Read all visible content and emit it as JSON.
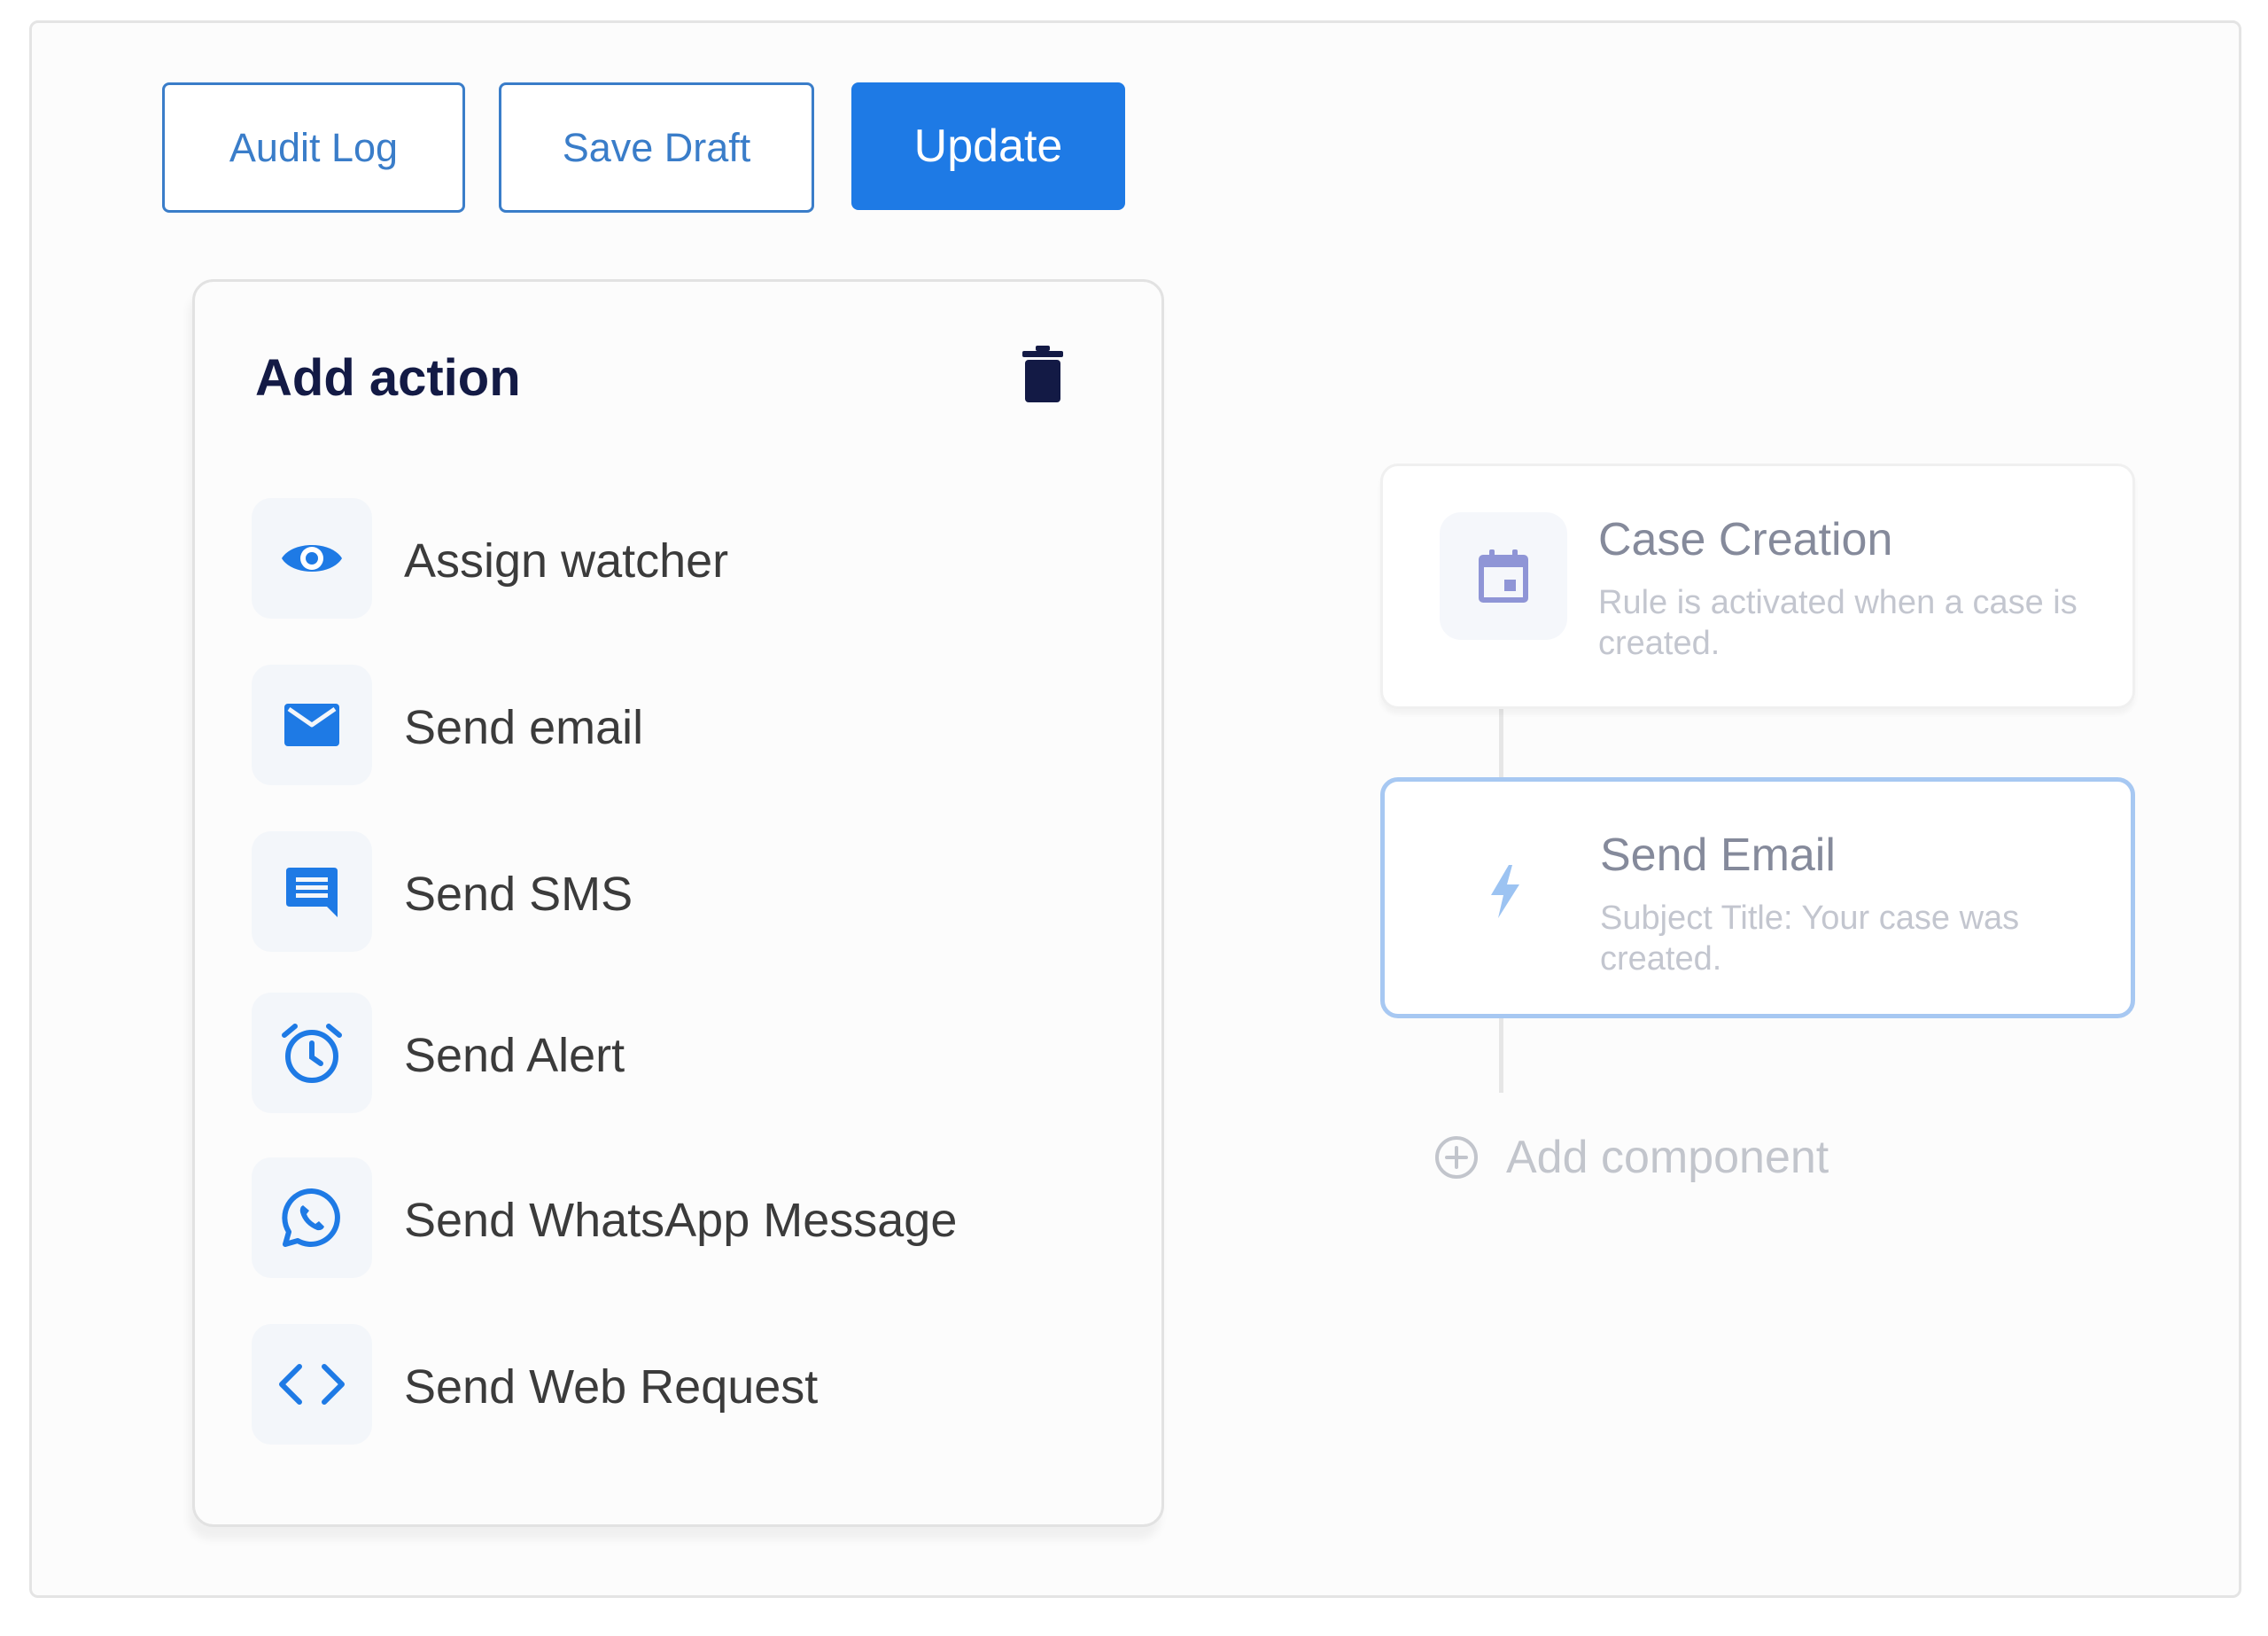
{
  "toolbar": {
    "audit_log_label": "Audit Log",
    "save_draft_label": "Save Draft",
    "update_label": "Update"
  },
  "add_action_panel": {
    "title": "Add action",
    "delete_icon": "trash-icon",
    "actions": [
      {
        "label": "Assign watcher",
        "icon": "eye-icon"
      },
      {
        "label": "Send email",
        "icon": "envelope-icon"
      },
      {
        "label": "Send SMS",
        "icon": "chat-message-icon"
      },
      {
        "label": "Send Alert",
        "icon": "alarm-clock-icon"
      },
      {
        "label": "Send WhatsApp Message",
        "icon": "whatsapp-icon"
      },
      {
        "label": "Send Web Request",
        "icon": "code-icon"
      }
    ]
  },
  "workflow": {
    "trigger": {
      "title": "Case Creation",
      "description": "Rule is activated when a case is created.",
      "icon": "calendar-icon"
    },
    "step": {
      "title": "Send Email",
      "description": "Subject Title: Your case was created.",
      "icon": "lightning-bolt-icon"
    },
    "add_component_label": "Add component",
    "add_component_icon": "plus-circle-icon"
  },
  "colors": {
    "accent": "#1e7ae5",
    "outline_button": "#3a7dc9",
    "title_dark": "#131a45",
    "selected_border": "#a7c8f2",
    "trigger_icon": "#8f95d6"
  }
}
